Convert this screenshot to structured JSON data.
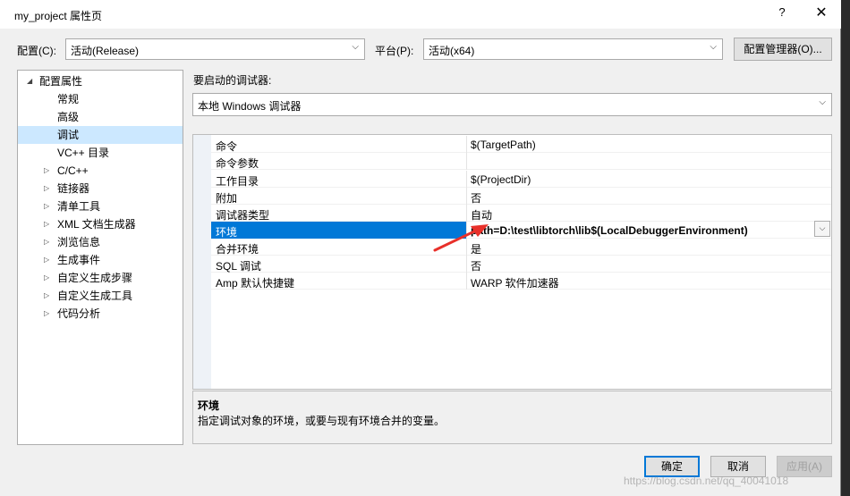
{
  "window": {
    "title": "my_project 属性页",
    "help_glyph": "?",
    "close_glyph": "✕"
  },
  "config": {
    "label": "配置(C):",
    "value": "活动(Release)",
    "platform_label": "平台(P):",
    "platform_value": "活动(x64)",
    "manager_button": "配置管理器(O)..."
  },
  "tree": {
    "items": [
      {
        "label": "配置属性",
        "expander": "◢"
      },
      {
        "label": "常规",
        "expander": ""
      },
      {
        "label": "高级",
        "expander": ""
      },
      {
        "label": "调试",
        "expander": "",
        "selected": true
      },
      {
        "label": "VC++ 目录",
        "expander": ""
      },
      {
        "label": "C/C++",
        "expander": "▷"
      },
      {
        "label": "链接器",
        "expander": "▷"
      },
      {
        "label": "清单工具",
        "expander": "▷"
      },
      {
        "label": "XML 文档生成器",
        "expander": "▷"
      },
      {
        "label": "浏览信息",
        "expander": "▷"
      },
      {
        "label": "生成事件",
        "expander": "▷"
      },
      {
        "label": "自定义生成步骤",
        "expander": "▷"
      },
      {
        "label": "自定义生成工具",
        "expander": "▷"
      },
      {
        "label": "代码分析",
        "expander": "▷"
      }
    ]
  },
  "debugger": {
    "label": "要启动的调试器:",
    "value": "本地 Windows 调试器"
  },
  "properties": [
    {
      "name": "命令",
      "value": "$(TargetPath)"
    },
    {
      "name": "命令参数",
      "value": ""
    },
    {
      "name": "工作目录",
      "value": "$(ProjectDir)"
    },
    {
      "name": "附加",
      "value": "否"
    },
    {
      "name": "调试器类型",
      "value": "自动"
    },
    {
      "name": "环境",
      "value": "path=D:\\test\\libtorch\\lib$(LocalDebuggerEnvironment)",
      "selected": true
    },
    {
      "name": "合并环境",
      "value": "是"
    },
    {
      "name": "SQL 调试",
      "value": "否"
    },
    {
      "name": "Amp 默认快捷键",
      "value": "WARP 软件加速器"
    }
  ],
  "description": {
    "title": "环境",
    "text": "指定调试对象的环境，或要与现有环境合并的变量。"
  },
  "buttons": {
    "ok": "确定",
    "cancel": "取消",
    "apply": "应用(A)"
  },
  "watermark": "https://blog.csdn.net/qq_40041018",
  "colors": {
    "selection": "#0078d7",
    "tree_selection": "#cce8ff",
    "annotation_arrow": "#e8302a"
  }
}
